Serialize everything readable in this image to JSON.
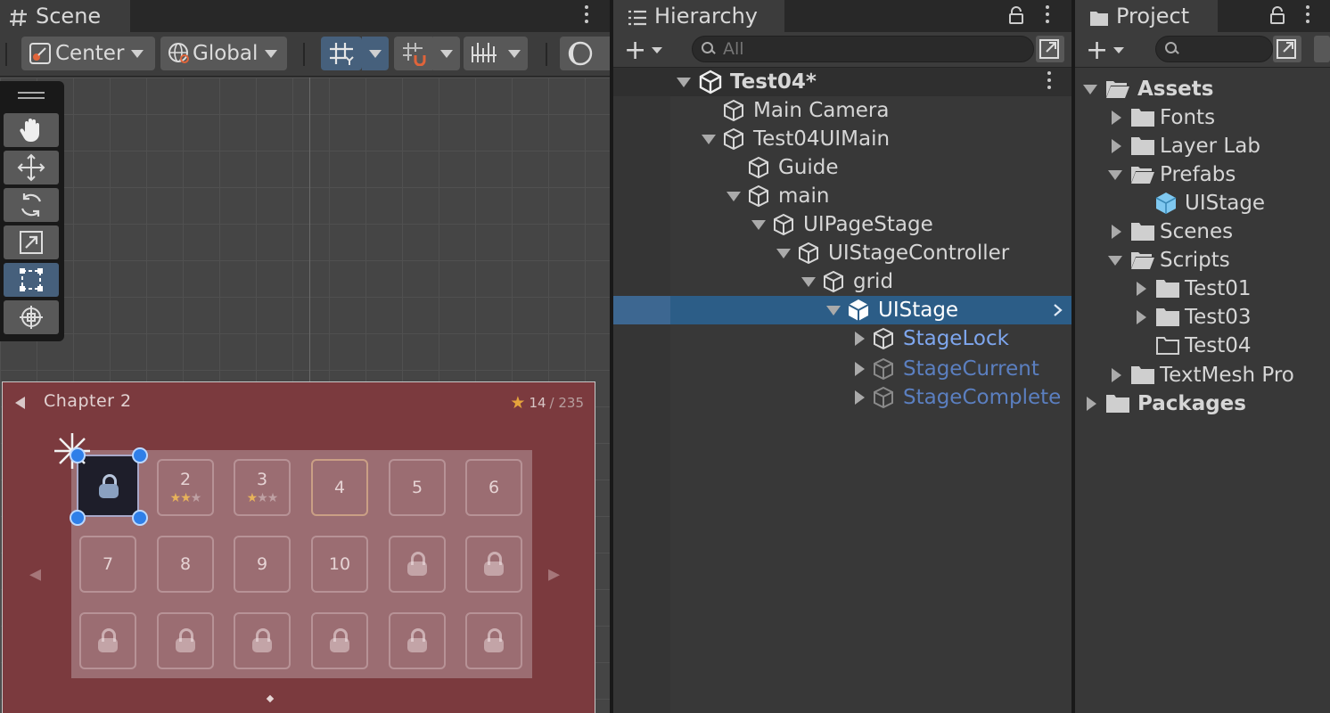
{
  "scene": {
    "tab_label": "Scene",
    "toolbar": {
      "pivot_mode": "Center",
      "pivot_rotation": "Global"
    },
    "game_view": {
      "chapter_title": "Chapter 2",
      "star_count": "14",
      "star_total": "/ 235",
      "stages": [
        {
          "label": "2",
          "stars_on": "★★",
          "stars_off": "★"
        },
        {
          "label": "3",
          "stars_on": "★",
          "stars_off": "★★"
        },
        {
          "label": "4"
        },
        {
          "label": "5"
        },
        {
          "label": "6"
        },
        {
          "label": "7"
        },
        {
          "label": "8"
        },
        {
          "label": "9"
        },
        {
          "label": "10"
        }
      ]
    }
  },
  "hierarchy": {
    "tab_label": "Hierarchy",
    "search_placeholder": "All",
    "items": [
      {
        "label": "Test04*"
      },
      {
        "label": "Main Camera"
      },
      {
        "label": "Test04UIMain"
      },
      {
        "label": "Guide"
      },
      {
        "label": "main"
      },
      {
        "label": "UIPageStage"
      },
      {
        "label": "UIStageController"
      },
      {
        "label": "grid"
      },
      {
        "label": "UIStage"
      },
      {
        "label": "StageLock"
      },
      {
        "label": "StageCurrent"
      },
      {
        "label": "StageComplete"
      }
    ]
  },
  "project": {
    "tab_label": "Project",
    "search_placeholder": "",
    "items": [
      {
        "label": "Assets"
      },
      {
        "label": "Fonts"
      },
      {
        "label": "Layer Lab"
      },
      {
        "label": "Prefabs"
      },
      {
        "label": "UIStage"
      },
      {
        "label": "Scenes"
      },
      {
        "label": "Scripts"
      },
      {
        "label": "Test01"
      },
      {
        "label": "Test03"
      },
      {
        "label": "Test04"
      },
      {
        "label": "TextMesh Pro"
      },
      {
        "label": "Packages"
      }
    ]
  },
  "colors": {
    "selection": "#2c5d87",
    "active_tool": "#46607c",
    "canvas": "#7b3a3e",
    "prefab_blue": "#7ea6ee"
  }
}
